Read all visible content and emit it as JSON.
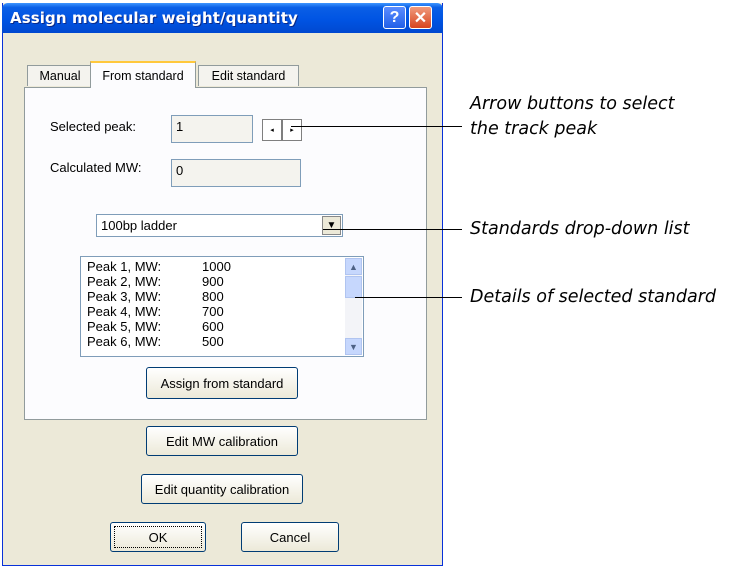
{
  "dialog": {
    "title": "Assign molecular weight/quantity",
    "help_glyph": "?",
    "close_glyph": "✕"
  },
  "tabs": [
    {
      "label": "Manual"
    },
    {
      "label": "From standard",
      "selected": true
    },
    {
      "label": "Edit standard"
    }
  ],
  "from_standard": {
    "selected_peak_label": "Selected peak:",
    "selected_peak_value": "1",
    "calculated_mw_label": "Calculated MW:",
    "calculated_mw_value": "0",
    "spin_left_glyph": "◂",
    "spin_right_glyph": "▸",
    "standard_select": {
      "selected": "100bp ladder",
      "arrow": "▼"
    },
    "peaks": [
      {
        "name": "Peak 1, MW:",
        "mw": "1000"
      },
      {
        "name": "Peak 2, MW:",
        "mw": "900"
      },
      {
        "name": "Peak 3, MW:",
        "mw": "800"
      },
      {
        "name": "Peak 4, MW:",
        "mw": "700"
      },
      {
        "name": "Peak 5, MW:",
        "mw": "600"
      },
      {
        "name": "Peak 6, MW:",
        "mw": "500"
      }
    ],
    "scroll_up_glyph": "▲",
    "scroll_down_glyph": "▼",
    "assign_button": "Assign from standard"
  },
  "buttons": {
    "edit_mw": "Edit MW calibration",
    "edit_quantity": "Edit quantity calibration",
    "ok": "OK",
    "cancel": "Cancel"
  },
  "callouts": {
    "arrow_buttons_line1": "Arrow buttons to select",
    "arrow_buttons_line2": "the track peak",
    "dropdown": "Standards drop-down list",
    "details": "Details of selected standard"
  },
  "colors": {
    "titlebar": "#0054e3",
    "dialog_bg": "#ece9d8",
    "panel_bg": "#fcfcfe",
    "close_button": "#d8451f"
  }
}
